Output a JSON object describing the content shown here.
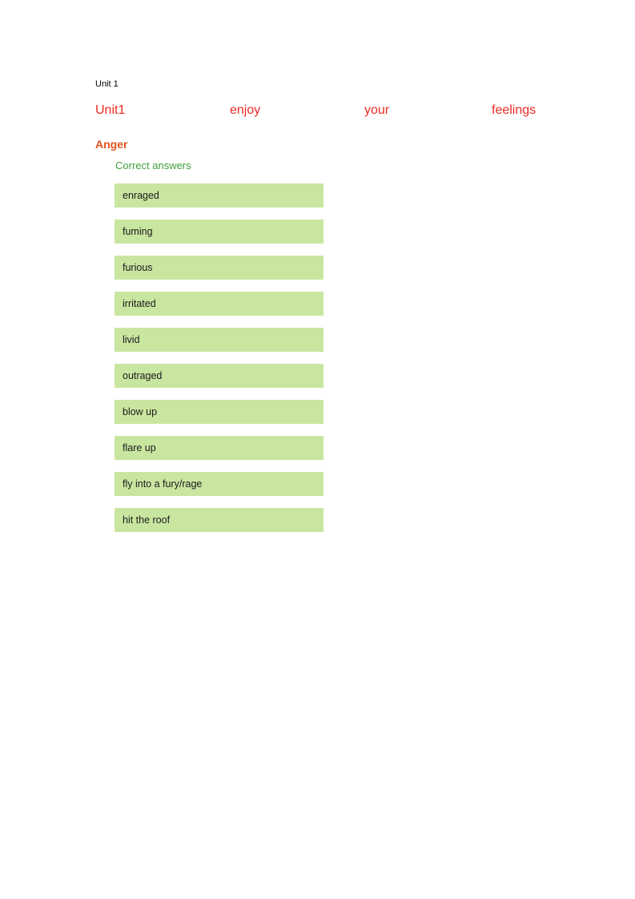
{
  "page": {
    "background_color": "#ffffff",
    "unit_label": "Unit 1"
  },
  "title_row": {
    "color": "#ee2a24",
    "words": [
      {
        "text": "Unit1"
      },
      {
        "text": "enjoy"
      },
      {
        "text": "your"
      },
      {
        "text": "feelings"
      }
    ]
  },
  "section": {
    "heading": "Anger",
    "heading_color": "#e2541d",
    "subheading": "Correct answers",
    "subheading_color": "#3fa03f"
  },
  "answers": {
    "item_background_color": "#c9e6a1",
    "items": [
      {
        "text": "enraged"
      },
      {
        "text": "fuming"
      },
      {
        "text": "furious"
      },
      {
        "text": "irritated"
      },
      {
        "text": "livid"
      },
      {
        "text": "outraged"
      },
      {
        "text": "blow up"
      },
      {
        "text": "flare up"
      },
      {
        "text": "fly into a fury/rage"
      },
      {
        "text": "hit the roof"
      }
    ]
  }
}
